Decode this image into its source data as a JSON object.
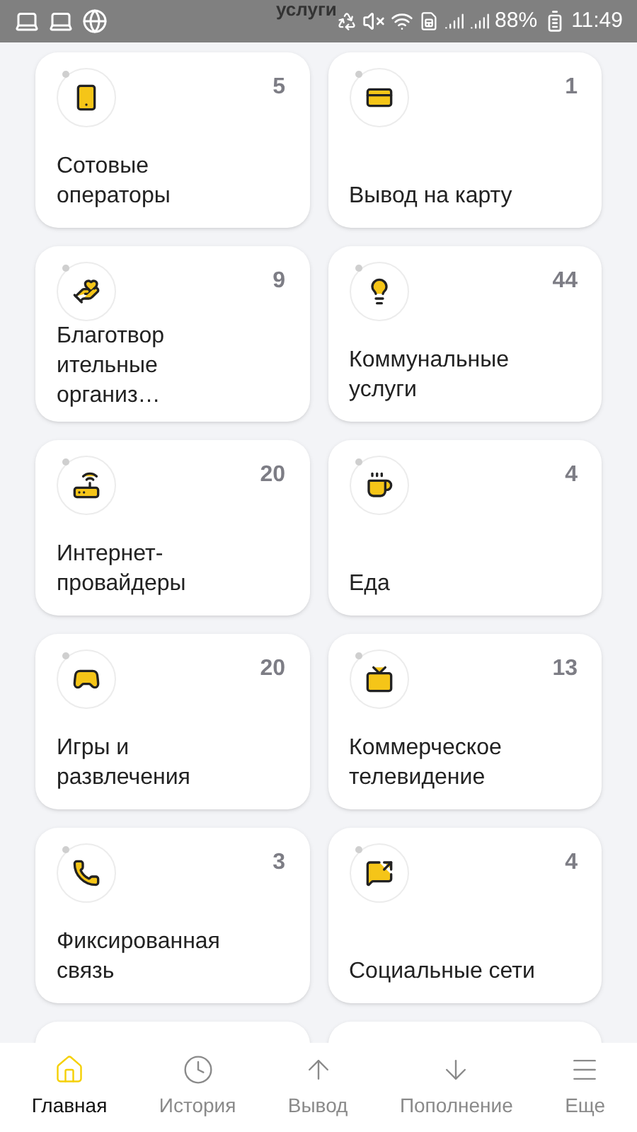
{
  "status_bar": {
    "header_title": "услуги",
    "battery": "88%",
    "time": "11:49"
  },
  "categories": [
    {
      "kind": "card",
      "title": "Сотовые операторы",
      "count": "5"
    },
    {
      "kind": "card",
      "title": "Вывод на карту",
      "count": "1"
    },
    {
      "kind": "card",
      "title": "Благотвор ительные организ…",
      "count": "9"
    },
    {
      "kind": "card",
      "title": "Коммунальные услуги",
      "count": "44"
    },
    {
      "kind": "card",
      "title": "Интернет-провайдеры",
      "count": "20"
    },
    {
      "kind": "card",
      "title": "Еда",
      "count": "4"
    },
    {
      "kind": "card",
      "title": "Игры и развлечения",
      "count": "20"
    },
    {
      "kind": "card",
      "title": "Коммерческое телевидение",
      "count": "13"
    },
    {
      "kind": "card",
      "title": "Фиксированная связь",
      "count": "3"
    },
    {
      "kind": "card",
      "title": "Социальные сети",
      "count": "4"
    },
    {
      "kind": "partial"
    },
    {
      "kind": "partial"
    }
  ],
  "bottom_nav": [
    {
      "label": "Главная",
      "selected": true
    },
    {
      "label": "История",
      "selected": false
    },
    {
      "label": "Вывод",
      "selected": false
    },
    {
      "label": "Пополнение",
      "selected": false
    },
    {
      "label": "Еще",
      "selected": false
    }
  ]
}
